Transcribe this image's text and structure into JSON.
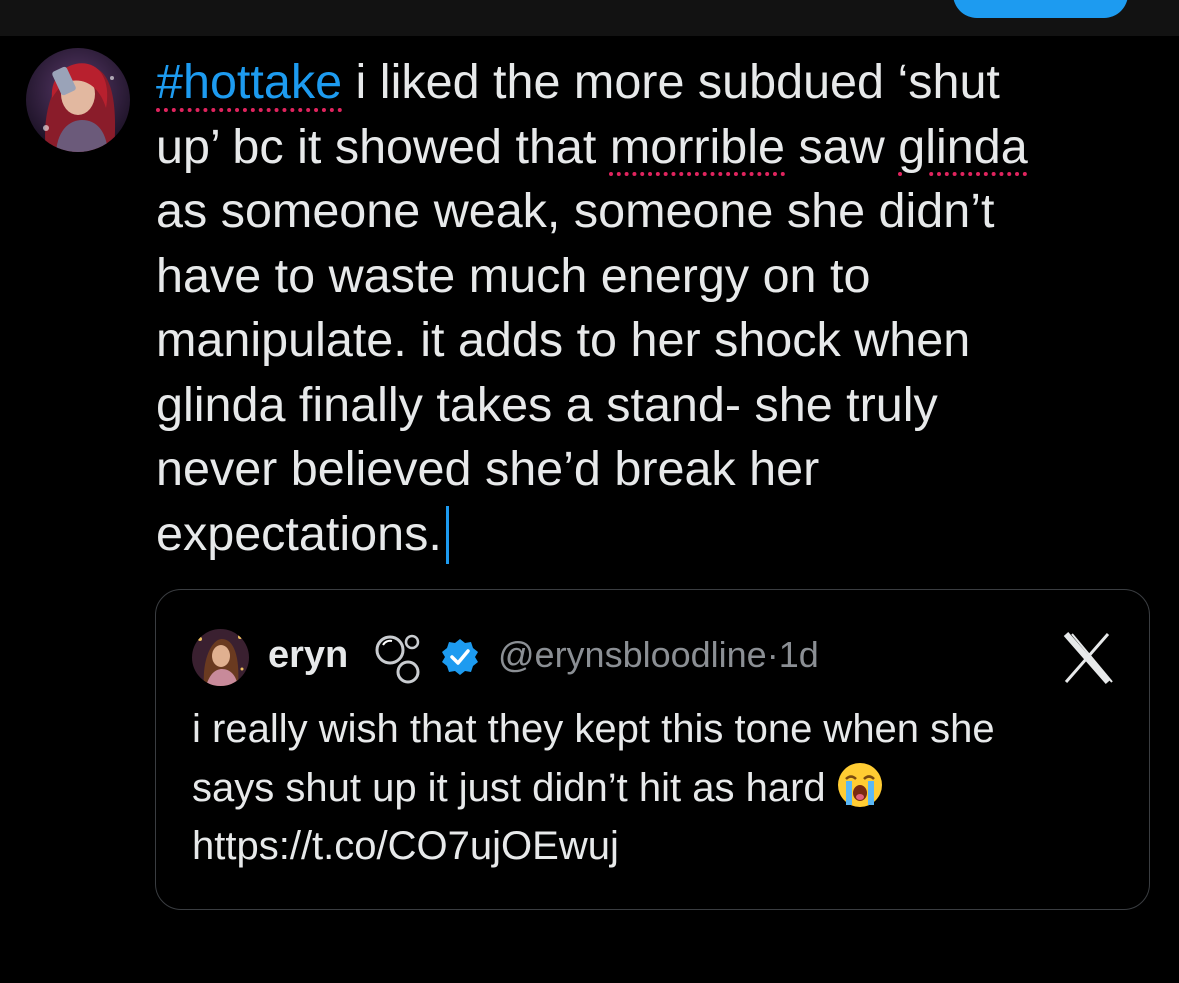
{
  "composer": {
    "hashtag": "#hottake",
    "line1_rest": " i liked the more subdued ‘shut",
    "line2_a": "up’ bc it showed that ",
    "line2_misspelled1": "morrible",
    "line2_b": " saw ",
    "line2_misspelled2": "glinda",
    "line3": "as someone weak, someone she didn’t",
    "line4": "have to waste much energy on to",
    "line5": "manipulate. it adds to her shock when",
    "line6": "glinda finally takes a stand- she truly",
    "line7": "never believed she’d break her",
    "line8": "expectations."
  },
  "quote": {
    "name": "eryn",
    "handle_time": "@erynsbloodline·1d",
    "text_line1": "i really wish that they kept this tone when she",
    "text_line2": "says shut up it just didn’t hit as hard",
    "text_line3": "https://t.co/CO7ujOEwuj",
    "emoji_icon": "loudly-crying-face-icon",
    "close_icon": "x-icon"
  },
  "colors": {
    "accent": "#1d9bf0",
    "background": "#000000",
    "text": "#e7e9ea",
    "muted": "#8b8f94",
    "spellcheck": "#e0245e"
  }
}
